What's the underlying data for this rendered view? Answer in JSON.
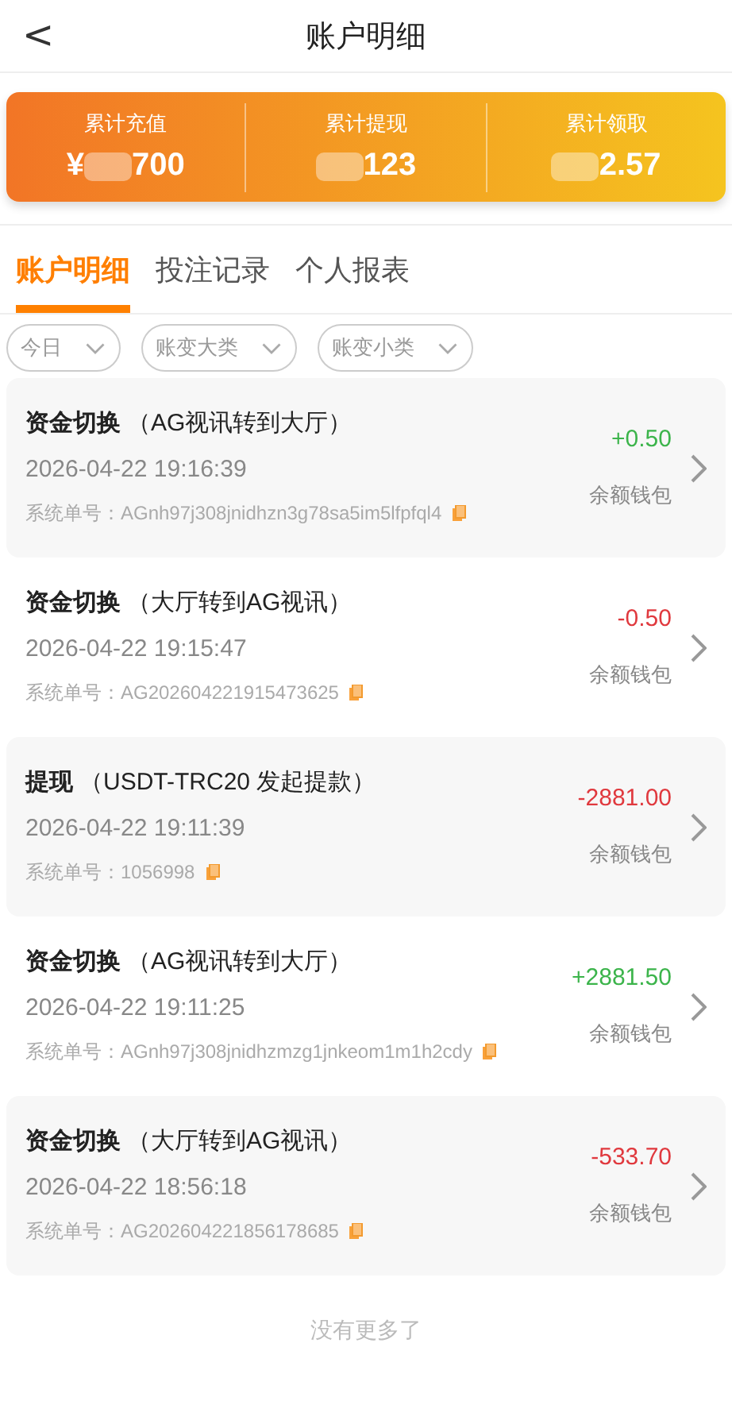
{
  "header": {
    "back": "<",
    "title": "账户明细"
  },
  "summary": [
    {
      "label": "累计充值",
      "prefix": "¥",
      "suffix": "700"
    },
    {
      "label": "累计提现",
      "suffix": "123"
    },
    {
      "label": "累计领取",
      "suffix": "2.57"
    }
  ],
  "tabs": [
    {
      "label": "账户明细",
      "selected": true
    },
    {
      "label": "投注记录",
      "selected": false
    },
    {
      "label": "个人报表",
      "selected": false
    }
  ],
  "filters": [
    {
      "label": "今日"
    },
    {
      "label": "账变大类"
    },
    {
      "label": "账变小类"
    }
  ],
  "records": [
    {
      "type": "资金切换",
      "detail": "（AG视讯转到大厅）",
      "time": "2026-04-22 19:16:39",
      "order_label": "系统单号：",
      "order": "AGnh97j308jnidhzn3g78sa5im5lfpfql4",
      "amount": "+0.50",
      "color": "#3cb44b",
      "wallet": "余额钱包"
    },
    {
      "type": "资金切换",
      "detail": "（大厅转到AG视讯）",
      "time": "2026-04-22 19:15:47",
      "order_label": "系统单号：",
      "order": "AG202604221915473625",
      "amount": "-0.50",
      "color": "#e0393e",
      "wallet": "余额钱包"
    },
    {
      "type": "提现",
      "detail": "（USDT-TRC20 发起提款）",
      "time": "2026-04-22 19:11:39",
      "order_label": "系统单号：",
      "order": "1056998",
      "amount": "-2881.00",
      "color": "#e0393e",
      "wallet": "余额钱包"
    },
    {
      "type": "资金切换",
      "detail": "（AG视讯转到大厅）",
      "time": "2026-04-22 19:11:25",
      "order_label": "系统单号：",
      "order": "AGnh97j308jnidhzmzg1jnkeom1m1h2cdy",
      "amount": "+2881.50",
      "color": "#3cb44b",
      "wallet": "余额钱包"
    },
    {
      "type": "资金切换",
      "detail": "（大厅转到AG视讯）",
      "time": "2026-04-22 18:56:18",
      "order_label": "系统单号：",
      "order": "AG202604221856178685",
      "amount": "-533.70",
      "color": "#e0393e",
      "wallet": "余额钱包"
    }
  ],
  "footer": "没有更多了"
}
